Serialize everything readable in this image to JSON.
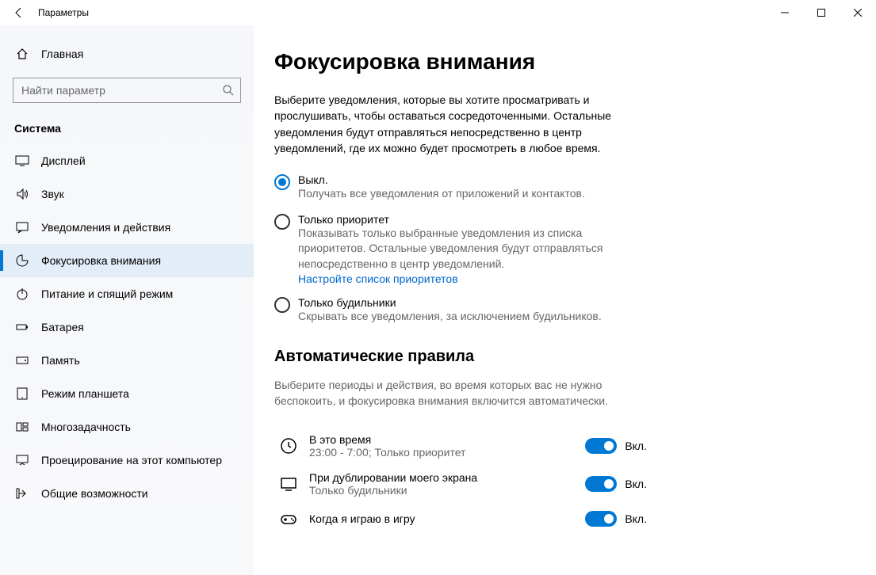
{
  "window": {
    "title": "Параметры"
  },
  "sidebar": {
    "home": "Главная",
    "search_placeholder": "Найти параметр",
    "category": "Система",
    "items": [
      {
        "id": "display",
        "label": "Дисплей"
      },
      {
        "id": "sound",
        "label": "Звук"
      },
      {
        "id": "notifications",
        "label": "Уведомления и действия"
      },
      {
        "id": "focus",
        "label": "Фокусировка внимания"
      },
      {
        "id": "power",
        "label": "Питание и спящий режим"
      },
      {
        "id": "battery",
        "label": "Батарея"
      },
      {
        "id": "storage",
        "label": "Память"
      },
      {
        "id": "tablet",
        "label": "Режим планшета"
      },
      {
        "id": "multitask",
        "label": "Многозадачность"
      },
      {
        "id": "projecting",
        "label": "Проецирование на этот компьютер"
      },
      {
        "id": "shared",
        "label": "Общие возможности"
      }
    ]
  },
  "main": {
    "heading": "Фокусировка внимания",
    "description": "Выберите уведомления, которые вы хотите просматривать и прослушивать, чтобы оставаться сосредоточенными. Остальные уведомления будут отправляться непосредственно в центр уведомлений, где их можно будет просмотреть в любое время.",
    "radios": {
      "off": {
        "label": "Выкл.",
        "desc": "Получать все уведомления от приложений и контактов."
      },
      "priority": {
        "label": "Только приоритет",
        "desc": "Показывать только выбранные уведомления из списка приоритетов. Остальные уведомления будут отправляться непосредственно в центр уведомлений.",
        "link": "Настройте список приоритетов"
      },
      "alarms": {
        "label": "Только будильники",
        "desc": "Скрывать все уведомления, за исключением будильников."
      }
    },
    "rules_heading": "Автоматические правила",
    "rules_desc": "Выберите периоды и действия, во время которых вас не нужно беспокоить, и фокусировка внимания включится автоматически.",
    "rules": {
      "time": {
        "title": "В это время",
        "sub": "23:00 - 7:00; Только приоритет",
        "state": "Вкл."
      },
      "duplicate": {
        "title": "При дублировании моего экрана",
        "sub": "Только будильники",
        "state": "Вкл."
      },
      "game": {
        "title": "Когда я играю в игру",
        "state": "Вкл."
      }
    }
  }
}
